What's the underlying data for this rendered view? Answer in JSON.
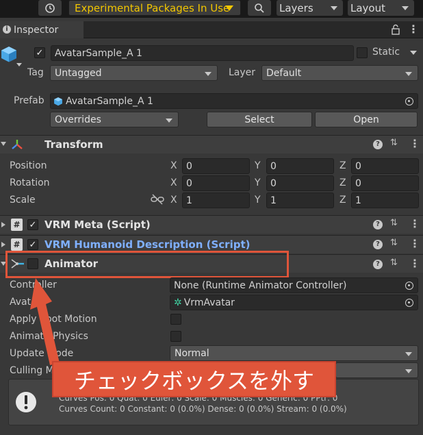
{
  "toolbar": {
    "packages_label": "Experimental Packages In Use",
    "layers_label": "Layers",
    "layout_label": "Layout"
  },
  "tab": {
    "title": "Inspector"
  },
  "object": {
    "name": "AvatarSample_A 1",
    "static_label": "Static",
    "tag_label": "Tag",
    "tag_value": "Untagged",
    "layer_label": "Layer",
    "layer_value": "Default",
    "prefab_label": "Prefab",
    "prefab_value": "AvatarSample_A 1",
    "overrides_label": "Overrides",
    "select_label": "Select",
    "open_label": "Open"
  },
  "transform": {
    "title": "Transform",
    "position_label": "Position",
    "rotation_label": "Rotation",
    "scale_label": "Scale",
    "x": "X",
    "y": "Y",
    "z": "Z",
    "position": [
      "0",
      "0",
      "0"
    ],
    "rotation": [
      "0",
      "0",
      "0"
    ],
    "scale": [
      "1",
      "1",
      "1"
    ]
  },
  "components": {
    "vrm_meta": "VRM Meta (Script)",
    "vrm_humanoid": "VRM Humanoid Description (Script)",
    "animator": "Animator"
  },
  "animator": {
    "controller_label": "Controller",
    "controller_value": "None (Runtime Animator Controller)",
    "avatar_label": "Avatar",
    "avatar_value": "VrmAvatar",
    "apply_root_motion_label": "Apply Root Motion",
    "animate_physics_label": "Animate Physics",
    "update_mode_label": "Update Mode",
    "update_mode_value": "Normal",
    "culling_mode_label": "Culling Mode",
    "info_line1": "Curves Pos: 0 Quat: 0 Euler: 0 Scale: 0 Muscles: 0 Generic: 0 PPtr: 0",
    "info_line2": "Curves Count: 0 Constant: 0 (0.0%) Dense: 0 (0.0%) Stream: 0 (0.0%)"
  },
  "annotation": {
    "callout_text": "チェックボックスを外す"
  },
  "colors": {
    "accent_orange": "#e0553a",
    "link_blue": "#7fb0ff",
    "ui_bg": "#383838"
  }
}
